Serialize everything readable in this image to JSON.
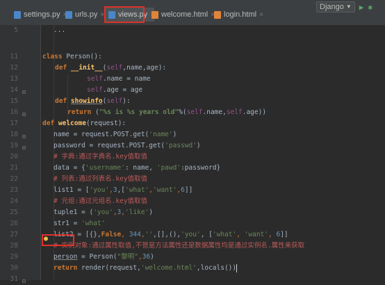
{
  "tabs": [
    {
      "label": "settings.py",
      "icon": "python-file-icon"
    },
    {
      "label": "urls.py",
      "icon": "python-file-icon"
    },
    {
      "label": "views.py",
      "icon": "python-file-icon"
    },
    {
      "label": "welcome.html",
      "icon": "html-file-icon"
    },
    {
      "label": "login.html",
      "icon": "html-file-icon"
    }
  ],
  "close_glyph": "×",
  "run_config": {
    "label": "Django",
    "play_icon": "run-icon",
    "debug_icon": "debug-icon"
  },
  "folded": "...",
  "line_numbers": [
    "5",
    "11",
    "12",
    "13",
    "14",
    "15",
    "16",
    "17",
    "18",
    "19",
    "20",
    "21",
    "22",
    "23",
    "24",
    "25",
    "26",
    "27",
    "28",
    "29",
    "30",
    "31",
    "32"
  ],
  "code": {
    "l13_kw": "class ",
    "l13_name": "Person",
    "l13_rest": "():",
    "l14_kw": "def ",
    "l14_name": "__init__",
    "l14_p1": "(",
    "l14_self": "self",
    "l14_p2": ",name,age):",
    "l15_self": "self",
    "l15_rest": ".name = name",
    "l16_self": "self",
    "l16_rest": ".age = age",
    "l17_kw": "def ",
    "l17_name": "showinfo",
    "l17_p1": "(",
    "l17_self": "self",
    "l17_p2": "):",
    "l18_kw": "return ",
    "l18_p1": "(",
    "l18_str": "\"%s is %s years old\"",
    "l18_p2": "%(",
    "l18_self1": "self",
    "l18_p3": ".name,",
    "l18_self2": "self",
    "l18_p4": ".age))",
    "l19_kw": "def ",
    "l19_name": "welcome",
    "l19_rest": "(request):",
    "l20_a": "name = request.POST.get(",
    "l20_str": "'name'",
    "l20_b": ")",
    "l21_a": "password = request.POST.get(",
    "l21_str": "'passwd'",
    "l21_b": ")",
    "l22_cmt": "# 字典:通过字典名.key值取值",
    "l23_a": "data = {",
    "l23_str1": "'username'",
    "l23_b": ": name, ",
    "l23_str2": "'pawd'",
    "l23_c": ":password}",
    "l24_cmt": "# 列表:通过列表名.key值取值",
    "l25_a": "list1 = [",
    "l25_s1": "'you'",
    "l25_b": ",",
    "l25_n1": "3",
    "l25_c": ",[",
    "l25_s2": "'what'",
    "l25_d": ",",
    "l25_s3": "'want'",
    "l25_e": ",",
    "l25_n2": "6",
    "l25_f": "]]",
    "l26_cmt": "# 元组:通过元组名.key值取值",
    "l27_a": "tuple1 = (",
    "l27_s1": "'you'",
    "l27_b": ",",
    "l27_n1": "3",
    "l27_c": ",",
    "l27_s2": "'like'",
    "l27_d": ")",
    "l28_a": "str1 = ",
    "l28_s1": "'what'",
    "l29_a": "list2 = [{},",
    "l29_kw": "False",
    "l29_b": ", ",
    "l29_n1": "344",
    "l29_c": ",",
    "l29_s1": "''",
    "l29_d": ",[],(),",
    "l29_s2": "'you'",
    "l29_e": ", [",
    "l29_s3": "'what'",
    "l29_f": ", ",
    "l29_s4": "'want'",
    "l29_g": ", ",
    "l29_n2": "6",
    "l29_h": "]]",
    "l30_cmt": "# 实例对象:通过属性取值,不管是方法属性还是数据属性均是通过实例名.属性来获取",
    "l31_var": "person",
    "l31_a": " = Person(",
    "l31_s1": "\"黎明\"",
    "l31_b": ",",
    "l31_n1": "36",
    "l31_c": ")",
    "l32_kw": "return ",
    "l32_a": "render(request,",
    "l32_s1": "'welcome.html'",
    "l32_b": ",locals())"
  },
  "colors": {
    "keyword": "#cc7832",
    "string": "#6a8759",
    "number": "#6897bb",
    "self": "#94558d",
    "comment": "#bc5a5a",
    "function": "#ffc66d",
    "highlight": "#e0312b"
  }
}
